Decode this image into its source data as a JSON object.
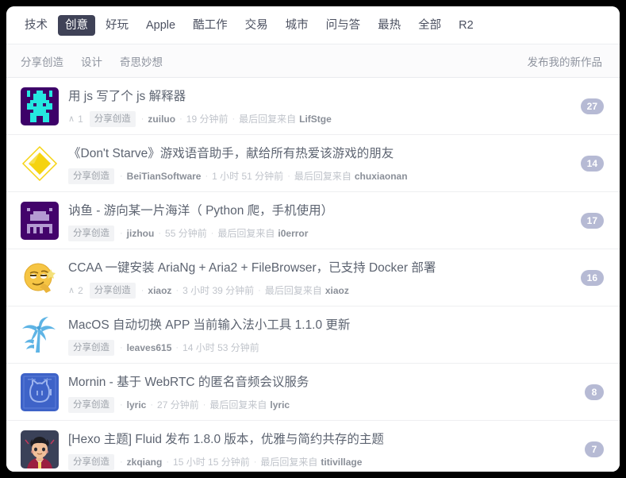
{
  "topnav": {
    "items": [
      {
        "label": "技术",
        "active": false
      },
      {
        "label": "创意",
        "active": true
      },
      {
        "label": "好玩",
        "active": false
      },
      {
        "label": "Apple",
        "active": false
      },
      {
        "label": "酷工作",
        "active": false
      },
      {
        "label": "交易",
        "active": false
      },
      {
        "label": "城市",
        "active": false
      },
      {
        "label": "问与答",
        "active": false
      },
      {
        "label": "最热",
        "active": false
      },
      {
        "label": "全部",
        "active": false
      },
      {
        "label": "R2",
        "active": false
      }
    ]
  },
  "subnav": {
    "items": [
      {
        "label": "分享创造"
      },
      {
        "label": "设计"
      },
      {
        "label": "奇思妙想"
      }
    ],
    "action_label": "发布我的新作品"
  },
  "labels": {
    "reply_from": "最后回复来自",
    "separator": "·"
  },
  "colors": {
    "active_tab_bg": "#3f4257",
    "badge_bg": "#b6bad4",
    "title": "#5d6471",
    "meta": "#b6bac1",
    "node_tag_bg": "#f2f3f5"
  },
  "posts": [
    {
      "avatar": "pixel-invader-cyan-avatar",
      "title": "用 js 写了个 js 解释器",
      "votes": "1",
      "node": "分享创造",
      "author": "zuiluo",
      "time": "19 分钟前",
      "reply_user": "LifStge",
      "count": "27"
    },
    {
      "avatar": "gold-diamond-avatar",
      "title": "《Don't Starve》游戏语音助手，献给所有热爱该游戏的朋友",
      "votes": "",
      "node": "分享创造",
      "author": "BeiTianSoftware",
      "time": "1 小时 51 分钟前",
      "reply_user": "chuxiaonan",
      "count": "14"
    },
    {
      "avatar": "pixel-invader-purple-avatar",
      "title": "讷鱼 - 游向某一片海洋（ Python 爬，手机使用）",
      "votes": "",
      "node": "分享创造",
      "author": "jizhou",
      "time": "55 分钟前",
      "reply_user": "i0error",
      "count": "17"
    },
    {
      "avatar": "smirk-emoji-avatar",
      "title": "CCAA 一键安装 AriaNg + Aria2 + FileBrowser，已支持 Docker 部署",
      "votes": "2",
      "node": "分享创造",
      "author": "xiaoz",
      "time": "3 小时 39 分钟前",
      "reply_user": "xiaoz",
      "count": "16"
    },
    {
      "avatar": "palm-tree-avatar",
      "title": "MacOS 自动切换 APP 当前输入法小工具 1.1.0 更新",
      "votes": "",
      "node": "分享创造",
      "author": "leaves615",
      "time": "14 小时 53 分钟前",
      "reply_user": "",
      "count": ""
    },
    {
      "avatar": "blue-cat-avatar",
      "title": "Mornin - 基于 WebRTC 的匿名音频会议服务",
      "votes": "",
      "node": "分享创造",
      "author": "lyric",
      "time": "27 分钟前",
      "reply_user": "lyric",
      "count": "8"
    },
    {
      "avatar": "cartoon-boy-avatar",
      "title": "[Hexo 主题] Fluid 发布 1.8.0 版本，优雅与简约共存的主题",
      "votes": "",
      "node": "分享创造",
      "author": "zkqiang",
      "time": "15 小时 15 分钟前",
      "reply_user": "titivillage",
      "count": "7"
    }
  ]
}
